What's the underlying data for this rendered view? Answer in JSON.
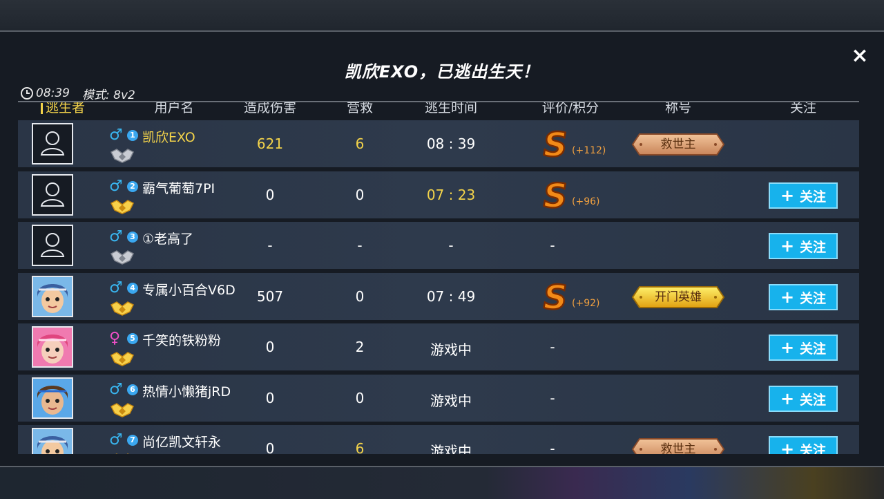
{
  "window": {
    "title": "凯欣EXO，已逃出生天！",
    "time": "08:39",
    "mode": "模式: 8v2",
    "close_label": "×"
  },
  "table": {
    "headers": [
      "逃生者",
      "用户名",
      "造成伤害",
      "营救",
      "逃生时间",
      "评价/积分",
      "称号",
      "关注"
    ],
    "follow_label": "关注",
    "rows": [
      {
        "rank": "1",
        "gender": "male",
        "gender_symbol": "♂",
        "name": "凯欣EXO",
        "damage": "621",
        "rescue": "6",
        "time": "08 : 39",
        "grade": "S",
        "points": "(+112)",
        "title": "救世主",
        "title_style": "bronze",
        "follow": false,
        "avatar": "default",
        "badge": "silver",
        "highlight": true
      },
      {
        "rank": "2",
        "gender": "male",
        "gender_symbol": "♂",
        "name": "霸气葡萄7PI",
        "damage": "0",
        "rescue": "0",
        "time": "07 : 23",
        "grade": "S",
        "points": "(+96)",
        "title": "",
        "follow": true,
        "avatar": "default",
        "badge": "gold",
        "time_highlight": true
      },
      {
        "rank": "3",
        "gender": "male",
        "gender_symbol": "♂",
        "name": "①老高了",
        "damage": "-",
        "rescue": "-",
        "time": "-",
        "grade": "",
        "grade_text": "-",
        "points": "",
        "title": "",
        "follow": true,
        "avatar": "default",
        "badge": "silver"
      },
      {
        "rank": "4",
        "gender": "male",
        "gender_symbol": "♂",
        "name": "专属小百合V6D",
        "damage": "507",
        "rescue": "0",
        "time": "07 : 49",
        "grade": "S",
        "points": "(+92)",
        "title": "开门英雄",
        "title_style": "gold",
        "follow": true,
        "avatar": "char-blue",
        "badge": "gold"
      },
      {
        "rank": "5",
        "gender": "female",
        "gender_symbol": "♀",
        "name": "千笑的铁粉粉",
        "damage": "0",
        "rescue": "2",
        "time": "游戏中",
        "grade": "",
        "grade_text": "-",
        "points": "",
        "title": "",
        "follow": true,
        "avatar": "char-pink",
        "badge": "gold"
      },
      {
        "rank": "6",
        "gender": "male",
        "gender_symbol": "♂",
        "name": "热情小懒猪jRD",
        "damage": "0",
        "rescue": "0",
        "time": "游戏中",
        "grade": "",
        "grade_text": "-",
        "points": "",
        "title": "",
        "follow": true,
        "avatar": "char-boy",
        "badge": "gold"
      },
      {
        "rank": "7",
        "gender": "male",
        "gender_symbol": "♂",
        "name": "尚亿凯文轩永",
        "damage": "0",
        "rescue": "6",
        "time": "游戏中",
        "grade": "",
        "grade_text": "-",
        "points": "",
        "title": "救世主",
        "title_style": "bronze",
        "follow": true,
        "avatar": "char-blue",
        "badge": "gold",
        "rescue_highlight": true
      }
    ]
  },
  "colors": {
    "accent_yellow": "#f3d34a",
    "follow_button": "#17b2ec",
    "male": "#39b6f0",
    "female": "#f04fc8",
    "points": "#f0a040"
  }
}
